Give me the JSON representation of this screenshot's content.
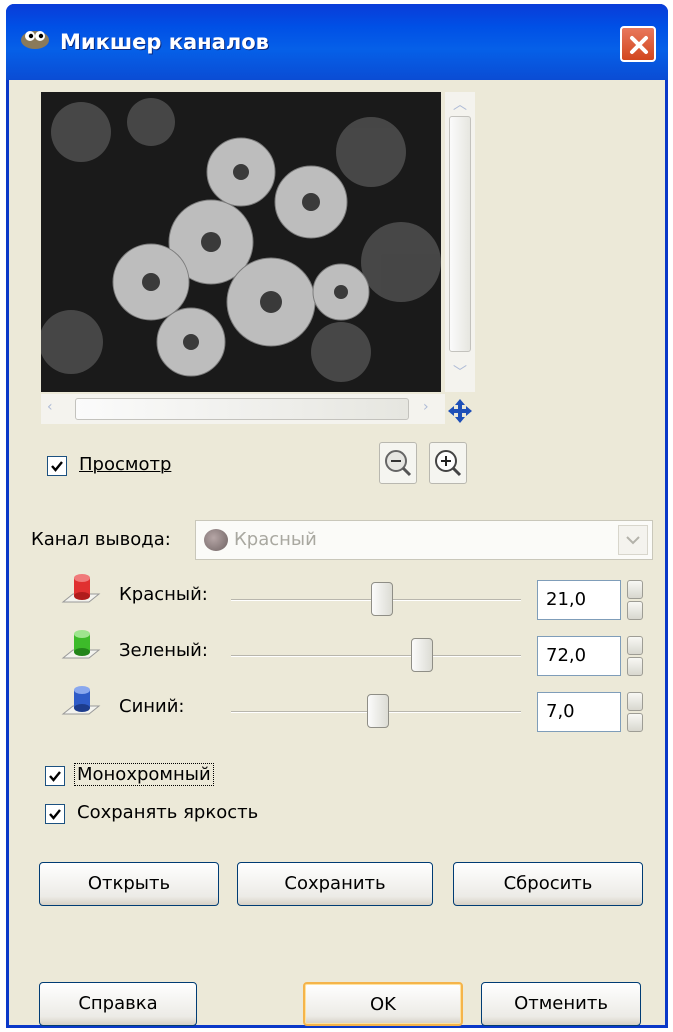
{
  "window": {
    "title": "Микшер каналов",
    "title_icon": "gimp-icon",
    "close_icon": "close-icon",
    "titlebar_color": "#0a50e0",
    "close_color": "#d84a22"
  },
  "preview": {
    "checkbox_label": "Просмотр",
    "checked": true,
    "zoom_out_icon": "zoom-out-icon",
    "zoom_in_icon": "zoom-in-icon"
  },
  "output_channel": {
    "label": "Канал вывода:",
    "value": "Красный"
  },
  "channels": [
    {
      "label": "Красный:",
      "value": "21,0",
      "level": 0.46,
      "color": "#e03030"
    },
    {
      "label": "Зеленый:",
      "value": "72,0",
      "level": 0.64,
      "color": "#3dbb2a"
    },
    {
      "label": "Синий:",
      "value": "7,0",
      "level": 0.47,
      "color": "#2f5cc8"
    }
  ],
  "options": [
    {
      "label": "Монохромный",
      "checked": true
    },
    {
      "label": "Сохранять яркость",
      "checked": true
    }
  ],
  "buttons_row1": {
    "open": "Открыть",
    "save": "Сохранить",
    "reset": "Сбросить"
  },
  "buttons_row2": {
    "help": "Справка",
    "ok": "OK",
    "cancel": "Отменить"
  }
}
